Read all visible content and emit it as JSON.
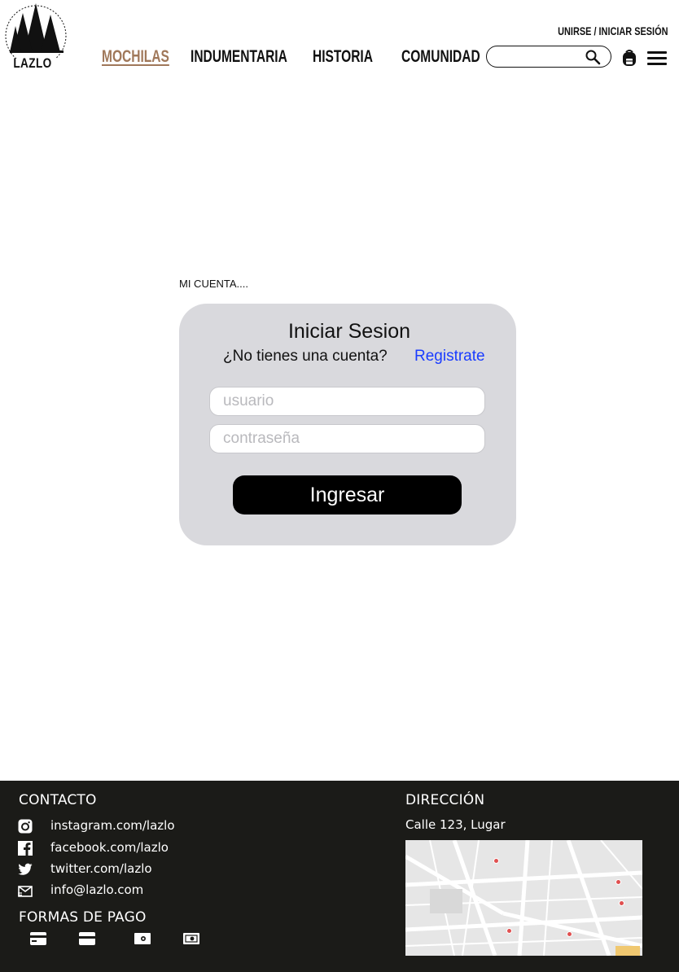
{
  "brand": {
    "name": "LAZLO"
  },
  "header": {
    "auth_link": "UNIRSE / INICIAR SESIÓN",
    "nav": [
      {
        "label": "MOCHILAS",
        "active": true
      },
      {
        "label": "INDUMENTARIA",
        "active": false
      },
      {
        "label": "HISTORIA",
        "active": false
      },
      {
        "label": "COMUNIDAD",
        "active": false
      }
    ],
    "search": {
      "value": "",
      "placeholder": ""
    },
    "icons": {
      "search": "search-icon",
      "bag": "backpack-icon",
      "menu": "hamburger-menu-icon"
    }
  },
  "main": {
    "section_title": "MI CUENTA....",
    "login": {
      "heading": "Iniciar Sesion",
      "no_account": "¿No tienes una cuenta?",
      "register_link": "Registrate",
      "username_placeholder": "usuario",
      "password_placeholder": "contraseña",
      "submit_label": "Ingresar"
    }
  },
  "footer": {
    "contact_heading": "CONTACTO",
    "contacts": [
      {
        "icon": "instagram-icon",
        "text": "instagram.com/lazlo"
      },
      {
        "icon": "facebook-icon",
        "text": "facebook.com/lazlo"
      },
      {
        "icon": "twitter-icon",
        "text": "twitter.com/lazlo"
      },
      {
        "icon": "email-icon",
        "text": "info@lazlo.com"
      }
    ],
    "payment_heading": "FORMAS DE PAGO",
    "payment_icons": [
      "credit-card-icon",
      "debit-card-icon",
      "cash-icon",
      "cash-icon"
    ],
    "address_heading": "DIRECCIÓN",
    "address": "Calle 123, Lugar"
  },
  "colors": {
    "accent": "#a0785a",
    "link": "#1a3cff",
    "card": "#d9d9dd",
    "footer_bg": "#1b1b18"
  }
}
